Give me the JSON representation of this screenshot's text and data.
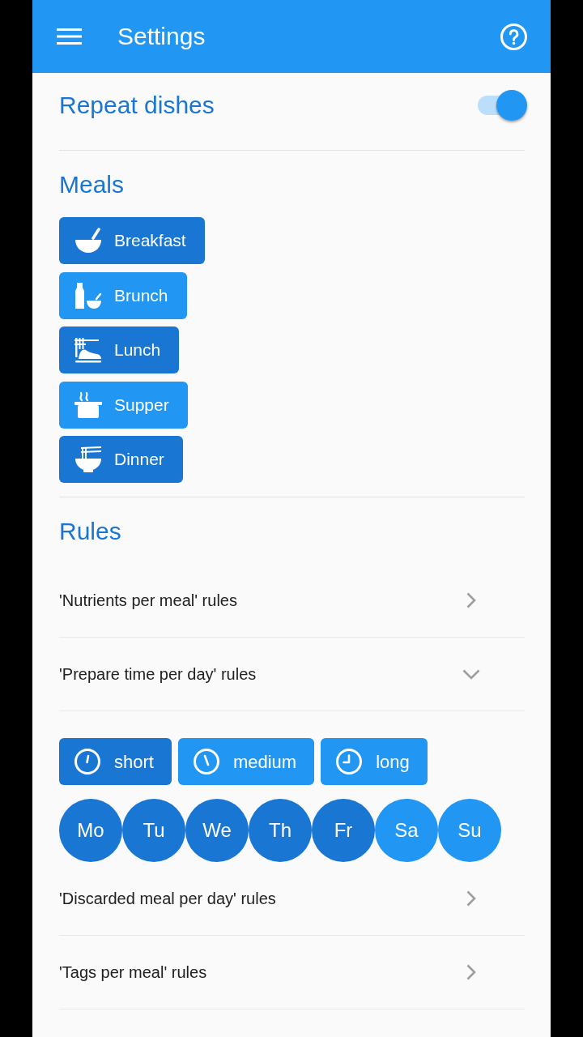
{
  "app_bar": {
    "title": "Settings"
  },
  "repeat_dishes": {
    "label": "Repeat dishes",
    "on": true
  },
  "meals": {
    "heading": "Meals",
    "items": [
      {
        "label": "Breakfast",
        "kind": "bowl",
        "selected": true
      },
      {
        "label": "Brunch",
        "kind": "bottle",
        "selected": false
      },
      {
        "label": "Lunch",
        "kind": "spaghetti",
        "selected": true
      },
      {
        "label": "Supper",
        "kind": "pot",
        "selected": false
      },
      {
        "label": "Dinner",
        "kind": "noodles",
        "selected": true
      }
    ]
  },
  "rules": {
    "heading": "Rules",
    "items": [
      {
        "label": "'Nutrients per meal' rules",
        "expanded": false
      },
      {
        "label": "'Prepare time per day' rules",
        "expanded": true,
        "durations": [
          {
            "label": "short",
            "kind": "short",
            "selected": true
          },
          {
            "label": "medium",
            "kind": "medium",
            "selected": false
          },
          {
            "label": "long",
            "kind": "long",
            "selected": false
          }
        ],
        "days": [
          {
            "label": "Mo",
            "selected": true
          },
          {
            "label": "Tu",
            "selected": true
          },
          {
            "label": "We",
            "selected": true
          },
          {
            "label": "Th",
            "selected": true
          },
          {
            "label": "Fr",
            "selected": true
          },
          {
            "label": "Sa",
            "selected": false
          },
          {
            "label": "Su",
            "selected": false
          }
        ]
      },
      {
        "label": "'Discarded meal per day' rules",
        "expanded": false
      },
      {
        "label": "'Tags per meal' rules",
        "expanded": false
      }
    ]
  }
}
